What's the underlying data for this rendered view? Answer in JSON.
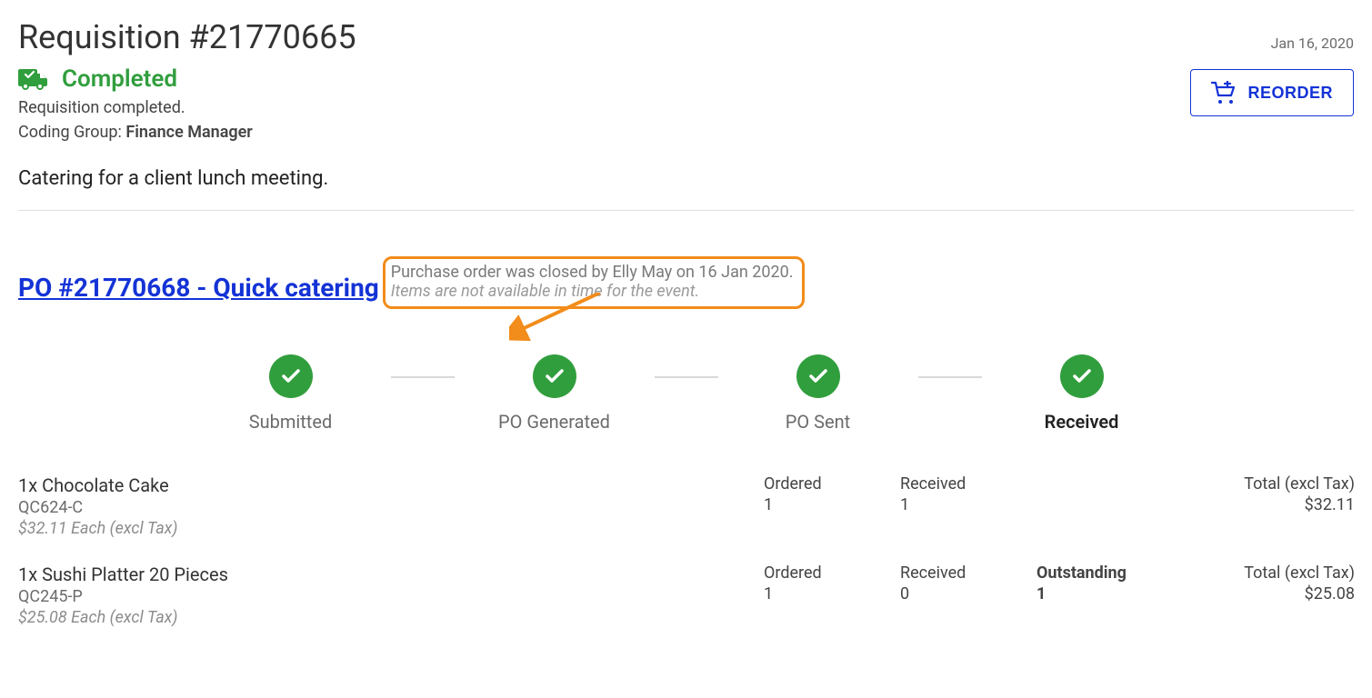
{
  "header": {
    "title": "Requisition #21770665",
    "date": "Jan 16, 2020"
  },
  "status": {
    "label": "Completed",
    "subtitle1": "Requisition completed.",
    "coding_group_label": "Coding Group: ",
    "coding_group_value": "Finance Manager",
    "reorder_label": "REORDER"
  },
  "description": "Catering for a client lunch meeting.",
  "po": {
    "link_text": "PO #21770668 - Quick catering",
    "closed_text": "Purchase order was closed by Elly May on 16 Jan 2020.",
    "reason_text": "Items are not available in time for the event."
  },
  "workflow": {
    "steps": [
      "Submitted",
      "PO Generated",
      "PO Sent",
      "Received"
    ],
    "active_index": 3
  },
  "item_headers": {
    "ordered": "Ordered",
    "received": "Received",
    "outstanding": "Outstanding",
    "total": "Total (excl Tax)"
  },
  "items": [
    {
      "name": "1x Chocolate Cake",
      "sku": "QC624-C",
      "unit_price": "$32.11 Each (excl Tax)",
      "ordered": "1",
      "received": "1",
      "outstanding": "",
      "total": "$32.11"
    },
    {
      "name": "1x Sushi Platter 20 Pieces",
      "sku": "QC245-P",
      "unit_price": "$25.08 Each (excl Tax)",
      "ordered": "1",
      "received": "0",
      "outstanding": "1",
      "total": "$25.08"
    }
  ]
}
